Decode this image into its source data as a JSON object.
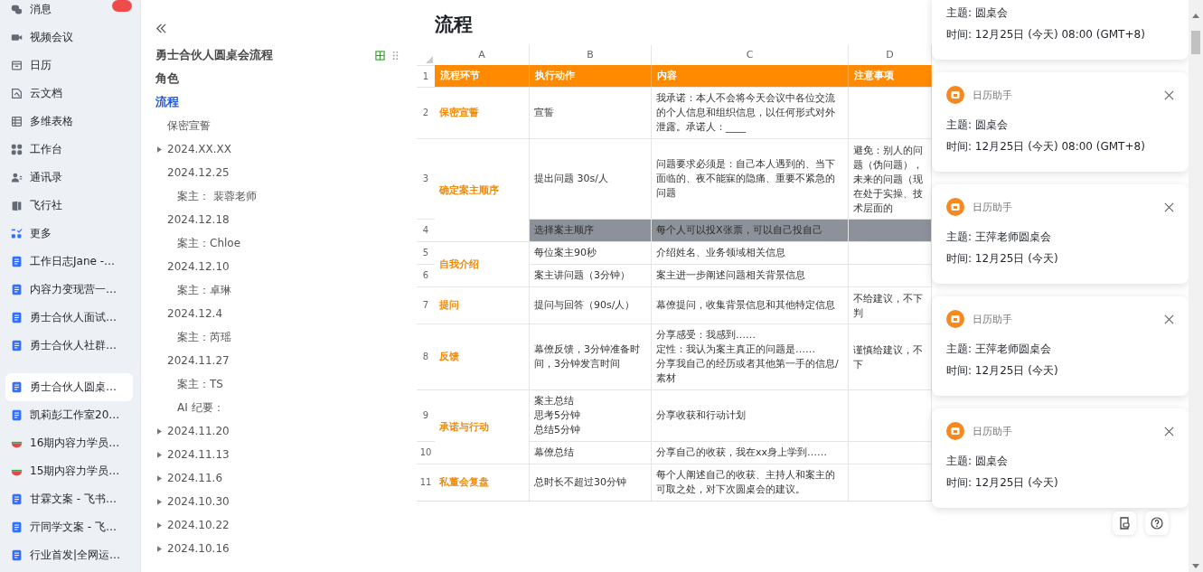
{
  "nav": {
    "items": [
      {
        "kind": "chat",
        "label": "消息",
        "selected": false,
        "badge": true
      },
      {
        "kind": "video",
        "label": "视频会议",
        "selected": false
      },
      {
        "kind": "calendar",
        "label": "日历",
        "selected": false
      },
      {
        "kind": "docs",
        "label": "云文档",
        "selected": false
      },
      {
        "kind": "base",
        "label": "多维表格",
        "selected": false
      },
      {
        "kind": "apps",
        "label": "工作台",
        "selected": false
      },
      {
        "kind": "contacts",
        "label": "通讯录",
        "selected": false
      },
      {
        "kind": "book",
        "label": "飞行社",
        "selected": false
      },
      {
        "kind": "more",
        "label": "更多",
        "selected": false
      },
      {
        "kind": "doc",
        "label": "工作日志Jane -…",
        "selected": false
      },
      {
        "kind": "doc",
        "label": "内容力变现营一…",
        "selected": false
      },
      {
        "kind": "doc",
        "label": "勇士合伙人面试…",
        "selected": false
      },
      {
        "kind": "doc",
        "label": "勇士合伙人社群…",
        "selected": false
      },
      {
        "kind": "gap"
      },
      {
        "kind": "doc",
        "label": "勇士合伙人圆桌…",
        "selected": true
      },
      {
        "kind": "doc",
        "label": "凯莉彭工作室20…",
        "selected": false
      },
      {
        "kind": "melon",
        "label": "16期内容力学员…",
        "selected": false
      },
      {
        "kind": "melon",
        "label": "15期内容力学员…",
        "selected": false
      },
      {
        "kind": "doc",
        "label": "甘霖文案 - 飞书…",
        "selected": false
      },
      {
        "kind": "doc",
        "label": "亓同学文案 - 飞…",
        "selected": false
      },
      {
        "kind": "doc",
        "label": "行业首发|全网运…",
        "selected": false
      }
    ]
  },
  "outline": {
    "title": "勇士合伙人圆桌会流程",
    "items": [
      {
        "label": "角色",
        "selected": false
      },
      {
        "label": "流程",
        "selected": true,
        "children": [
          {
            "label": "保密宣誓",
            "selected": false
          },
          {
            "label": "2024.XX.XX",
            "selected": false,
            "expanded": false
          },
          {
            "label": "2024.12.25",
            "selected": false,
            "expanded": true,
            "children": [
              {
                "label": "案主： 裴蓉老师",
                "selected": false
              }
            ]
          },
          {
            "label": "2024.12.18",
            "selected": false,
            "expanded": true,
            "children": [
              {
                "label": "案主：Chloe",
                "selected": false
              }
            ]
          },
          {
            "label": "2024.12.10",
            "selected": false,
            "expanded": true,
            "children": [
              {
                "label": "案主：卓琳",
                "selected": false
              }
            ]
          },
          {
            "label": "2024.12.4",
            "selected": false,
            "expanded": true,
            "children": [
              {
                "label": "案主：芮瑶",
                "selected": false
              }
            ]
          },
          {
            "label": "2024.11.27",
            "selected": false,
            "expanded": true,
            "children": [
              {
                "label": "案主：TS",
                "selected": false
              },
              {
                "label": "AI 纪要：",
                "selected": false
              }
            ]
          },
          {
            "label": "2024.11.20",
            "selected": false,
            "expanded": false
          },
          {
            "label": "2024.11.13",
            "selected": false,
            "expanded": false
          },
          {
            "label": "2024.11.6",
            "selected": false,
            "expanded": false
          },
          {
            "label": "2024.10.30",
            "selected": false,
            "expanded": false
          },
          {
            "label": "2024.10.22",
            "selected": false,
            "expanded": false
          },
          {
            "label": "2024.10.16",
            "selected": false,
            "expanded": false
          }
        ]
      }
    ]
  },
  "page": {
    "title": "流程"
  },
  "table": {
    "columns": [
      "A",
      "B",
      "C",
      "D"
    ],
    "header": {
      "num": "1",
      "cells": [
        "流程环节",
        "执行动作",
        "内容",
        "注意事项"
      ]
    },
    "groups": [
      {
        "stage": "保密宣誓",
        "rows": [
          {
            "num": "2",
            "action": "宣誓",
            "content": "我承诺：本人不会将今天会议中各位交流的个人信息和组织信息，以任何形式对外泄露。承诺人：____",
            "highlighted": false
          }
        ]
      },
      {
        "stage": "确定案主顺序",
        "rows": [
          {
            "num": "3",
            "action": "提出问题 30s/人",
            "content": "问题要求必须是：自己本人遇到的、当下面临的、夜不能寐的隐痛、重要不紧急的问题",
            "note": "避免：别人的问题（伪问题），未来的问题（现在处于实操、技术层面的",
            "highlighted": false
          },
          {
            "num": "4",
            "action": "选择案主顺序",
            "content": "每个人可以投X张票，可以自己投自己",
            "highlighted": true
          }
        ]
      },
      {
        "stage": "自我介绍",
        "rows": [
          {
            "num": "5",
            "action": "每位案主90秒",
            "content": "介绍姓名、业务领域相关信息",
            "highlighted": false
          },
          {
            "num": "6",
            "action": "案主讲问题（3分钟）",
            "content": "案主进一步阐述问题相关背景信息",
            "highlighted": false
          }
        ]
      },
      {
        "stage": "提问",
        "rows": [
          {
            "num": "7",
            "action": "提问与回答（90s/人）",
            "content": "幕僚提问，收集背景信息和其他特定信息",
            "note": "不给建议，不下判",
            "highlighted": false
          }
        ]
      },
      {
        "stage": "反馈",
        "rows": [
          {
            "num": "8",
            "action": "幕僚反馈，3分钟准备时间，3分钟发言时间",
            "content": [
              "分享感受：我感到……",
              "定性：我认为案主真正的问题是……",
              "分享我自己的经历或者其他第一手的信息/素材"
            ],
            "note": "谨慎给建议，不下",
            "highlighted": false
          }
        ]
      },
      {
        "stage": "承诺与行动",
        "rows": [
          {
            "num": "9",
            "action": [
              "案主总结",
              "思考5分钟",
              "总结5分钟"
            ],
            "content": "分享收获和行动计划",
            "highlighted": false
          },
          {
            "num": "10",
            "action": "幕僚总结",
            "content": "分享自己的收获，我在xx身上学到……",
            "highlighted": false
          }
        ]
      },
      {
        "stage": "私董会复盘",
        "rows": [
          {
            "num": "11",
            "action": "总时长不超过30分钟",
            "content": "每个人阐述自己的收获、主持人和案主的可取之处，对下次圆桌会的建议。",
            "highlighted": false
          }
        ]
      }
    ]
  },
  "notifications": [
    {
      "subject": "主题: 圆桌会",
      "time": "时间: 12月25日 (今天) 08:00 (GMT+8)"
    },
    {
      "app": "日历助手",
      "subject": "主题: 圆桌会",
      "time": "时间: 12月25日 (今天) 08:00 (GMT+8)"
    },
    {
      "app": "日历助手",
      "subject": "主题: 王萍老师圆桌会",
      "time": "时间: 12月25日 (今天)"
    },
    {
      "app": "日历助手",
      "subject": "主题: 王萍老师圆桌会",
      "time": "时间: 12月25日 (今天)"
    },
    {
      "app": "日历助手",
      "subject": "主题: 圆桌会",
      "time": "时间: 12月25日 (今天)"
    }
  ]
}
